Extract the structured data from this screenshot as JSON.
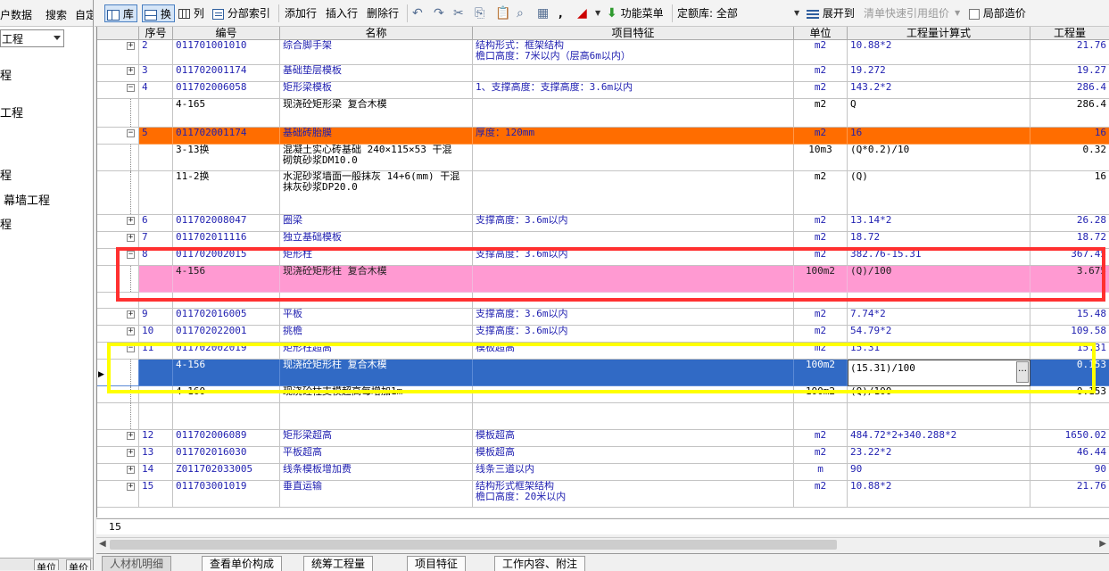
{
  "left_panel": {
    "tabs": [
      "户数据",
      "搜索",
      "自定"
    ],
    "select_value": "工程",
    "items": [
      "程",
      "工程",
      "程",
      "幕墙工程",
      "程"
    ],
    "bottom_tabs": [
      "单位",
      "单价"
    ]
  },
  "toolbar": {
    "lib": "库",
    "swap": "换",
    "col": "列",
    "section_index": "分部索引",
    "add_row": "添加行",
    "insert_row": "插入行",
    "delete_row": "删除行",
    "function_menu": "功能菜单",
    "quota_lib_label": "定额库: 全部",
    "expand_to": "展开到",
    "clear_price": "清单快速引用组价",
    "local_cost": "局部造价"
  },
  "grid": {
    "columns": [
      "序号",
      "编号",
      "名称",
      "项目特征",
      "单位",
      "工程量计算式",
      "工程量"
    ],
    "rows": [
      {
        "num": "2",
        "code": "011701001010",
        "name": "综合脚手架",
        "feature": "结构形式：框架结构\n檐口高度：7米以内（层高6m以内）",
        "unit": "m2",
        "formula": "10.88*2",
        "qty": "21.76"
      },
      {
        "num": "3",
        "code": "011702001174",
        "name": "基础垫层模板",
        "feature": "",
        "unit": "m2",
        "formula": "19.272",
        "qty": "19.27"
      },
      {
        "num": "4",
        "code": "011702006058",
        "name": "矩形梁模板",
        "feature": "1、支撑高度：支撑高度：3.6m以内",
        "unit": "m2",
        "formula": "143.2*2",
        "qty": "286.4"
      },
      {
        "num": "",
        "code": "4-165",
        "name": "现浇砼矩形梁 复合木模",
        "feature": "",
        "unit": "m2",
        "formula": "Q",
        "qty": "286.4"
      },
      {
        "num": "5",
        "code": "011702001174",
        "name": "基础砖胎膜",
        "feature": "厚度：120mm",
        "unit": "m2",
        "formula": "16",
        "qty": "16"
      },
      {
        "num": "",
        "code": "3-13换",
        "name": "混凝土实心砖基础 240×115×53 干混\n砌筑砂浆DM10.0",
        "feature": "",
        "unit": "10m3",
        "formula": "(Q*0.2)/10",
        "qty": "0.32"
      },
      {
        "num": "",
        "code": "11-2换",
        "name": "水泥砂浆墙面一般抹灰 14+6(mm) 干混\n抹灰砂浆DP20.0",
        "feature": "",
        "unit": "m2",
        "formula": "(Q)",
        "qty": "16"
      },
      {
        "num": "6",
        "code": "011702008047",
        "name": "圈梁",
        "feature": "支撑高度：3.6m以内",
        "unit": "m2",
        "formula": "13.14*2",
        "qty": "26.28"
      },
      {
        "num": "7",
        "code": "011702011116",
        "name": "独立基础模板",
        "feature": "",
        "unit": "m2",
        "formula": "18.72",
        "qty": "18.72"
      },
      {
        "num": "8",
        "code": "011702002015",
        "name": "矩形柱",
        "feature": "支撑高度：3.6m以内",
        "unit": "m2",
        "formula": "382.76-15.31",
        "qty": "367.45"
      },
      {
        "num": "",
        "code": "4-156",
        "name": "现浇砼矩形柱 复合木模",
        "feature": "",
        "unit": "100m2",
        "formula": "(Q)/100",
        "qty": "3.675"
      },
      {
        "num": "9",
        "code": "011702016005",
        "name": "平板",
        "feature": "支撑高度：3.6m以内",
        "unit": "m2",
        "formula": "7.74*2",
        "qty": "15.48"
      },
      {
        "num": "10",
        "code": "011702022001",
        "name": "挑檐",
        "feature": "支撑高度：3.6m以内",
        "unit": "m2",
        "formula": "54.79*2",
        "qty": "109.58"
      },
      {
        "num": "11",
        "code": "011702002019",
        "name": "矩形柱超高",
        "feature": "模板超高",
        "unit": "m2",
        "formula": "15.31",
        "qty": "15.31"
      },
      {
        "num": "",
        "code": "4-156",
        "name": "现浇砼矩形柱 复合木模",
        "feature": "",
        "unit": "100m2",
        "formula": "(15.31)/100",
        "qty": "0.153"
      },
      {
        "num": "",
        "code": "4-160",
        "name": "现浇砼柱支模超高每增加1m",
        "feature": "",
        "unit": "100m2",
        "formula": "(Q)/100",
        "qty": "0.153"
      },
      {
        "num": "12",
        "code": "011702006089",
        "name": "矩形梁超高",
        "feature": "模板超高",
        "unit": "m2",
        "formula": "484.72*2+340.288*2",
        "qty": "1650.02"
      },
      {
        "num": "13",
        "code": "011702016030",
        "name": "平板超高",
        "feature": "模板超高",
        "unit": "m2",
        "formula": "23.22*2",
        "qty": "46.44"
      },
      {
        "num": "14",
        "code": "Z011702033005",
        "name": "线条模板增加费",
        "feature": "线条三道以内",
        "unit": "m",
        "formula": "90",
        "qty": "90"
      },
      {
        "num": "15",
        "code": "011703001019",
        "name": "垂直运输",
        "feature": "结构形式框架结构\n檐口高度：20米以内",
        "unit": "m2",
        "formula": "10.88*2",
        "qty": "21.76"
      }
    ],
    "editor_value": "(15.31)/100",
    "status_value": "15"
  },
  "bottom_tabs": [
    "人材机明细",
    "查看单价构成",
    "统筹工程量",
    "项目特征",
    "工作内容、附注"
  ],
  "colors": {
    "selection": "#316ac5",
    "orange_row": "#ff6d00",
    "pink_row": "#ff9ad2",
    "red_highlight": "#ff3030",
    "yellow_highlight": "#ffff00",
    "blue_text": "#1f1fb0"
  }
}
